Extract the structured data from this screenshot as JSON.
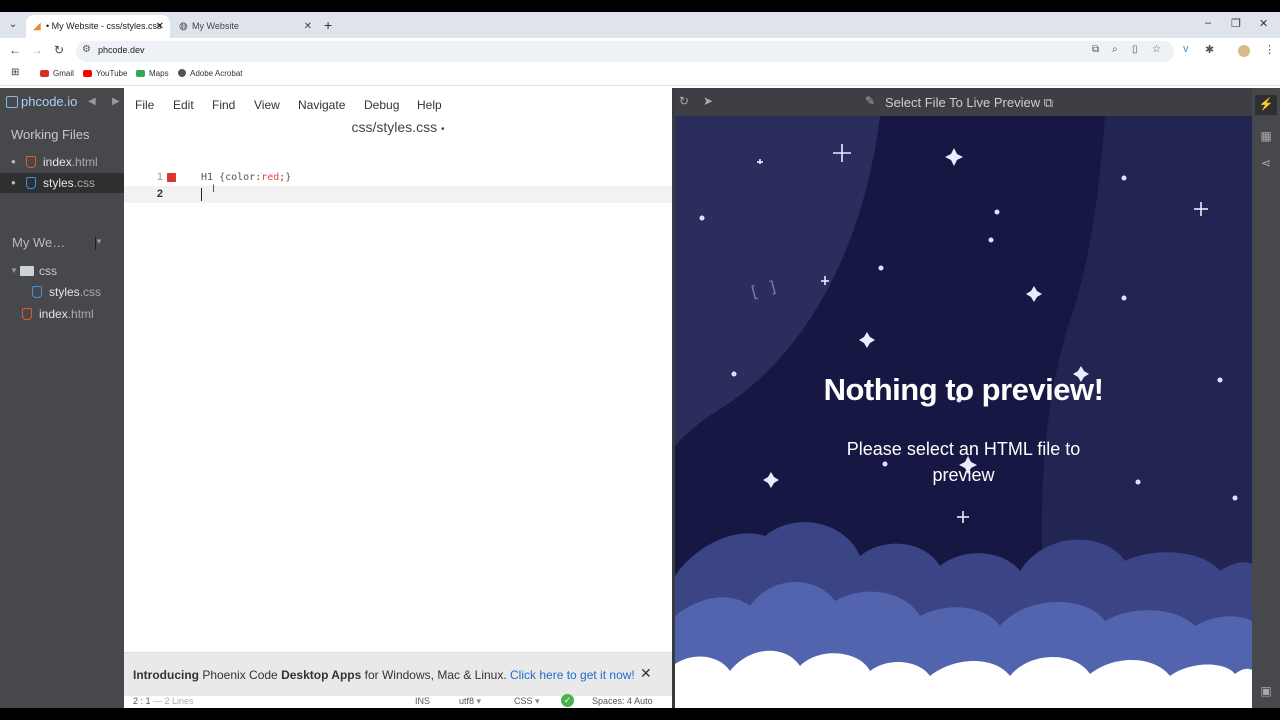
{
  "browser": {
    "tabs": [
      {
        "title": "• My Website - css/styles.css",
        "favicon": "phoenix-icon",
        "close": "✕"
      },
      {
        "title": "My Website",
        "favicon": "globe-icon",
        "close": "✕"
      }
    ],
    "new_tab": "+",
    "window_controls": [
      "–",
      "❐",
      "✕"
    ],
    "url": "phcode.dev",
    "bookmarks": [
      {
        "label": "Gmail",
        "color": "#d93025"
      },
      {
        "label": "YouTube",
        "color": "#ff0000"
      },
      {
        "label": "Maps",
        "color": "#34a853"
      },
      {
        "label": "Adobe Acrobat",
        "color": "#555555"
      }
    ]
  },
  "sidebar": {
    "logo": "phcode.io",
    "working_files_heading": "Working Files",
    "working_files": [
      {
        "base": "index",
        "ext": ".html",
        "type": "html"
      },
      {
        "base": "styles",
        "ext": ".css",
        "type": "css",
        "selected": true
      }
    ],
    "project_name": "My We…",
    "tree": [
      {
        "name": "css",
        "type": "folder"
      },
      {
        "base": "styles",
        "ext": ".css",
        "type": "css"
      },
      {
        "base": "index",
        "ext": ".html",
        "type": "html"
      }
    ]
  },
  "editor": {
    "menus": [
      "File",
      "Edit",
      "Find",
      "View",
      "Navigate",
      "Debug",
      "Help"
    ],
    "file_title": "css/styles.css",
    "dirty_marker": "•",
    "lines": [
      {
        "num": "1",
        "selector": "H1",
        "rest_pre": " {color:",
        "value": "red",
        "rest_post": ";}"
      },
      {
        "num": "2"
      }
    ],
    "banner": {
      "t1": "Introducing",
      "t2": " Phoenix Code ",
      "t3": "Desktop Apps",
      "t4": " for Windows, Mac & Linux. ",
      "link": "Click here to get it now!",
      "close": "✕"
    },
    "status": {
      "cursor": "2 : 1",
      "lines": "— 2 Lines",
      "mode": "INS",
      "encoding": "utf8",
      "language": "CSS",
      "spaces": "Spaces:",
      "spaces_value": "4",
      "auto": "Auto"
    }
  },
  "preview": {
    "toolbar_title": "Select File To Live Preview",
    "heading": "Nothing to preview!",
    "subtext": "Please select an HTML file to preview",
    "colors": {
      "sky": "#161743",
      "band": "#2b2d5c",
      "cloud_dark": "#4a5597",
      "cloud_mid": "#6a7ec6",
      "cloud_light": "#ffffff"
    }
  }
}
